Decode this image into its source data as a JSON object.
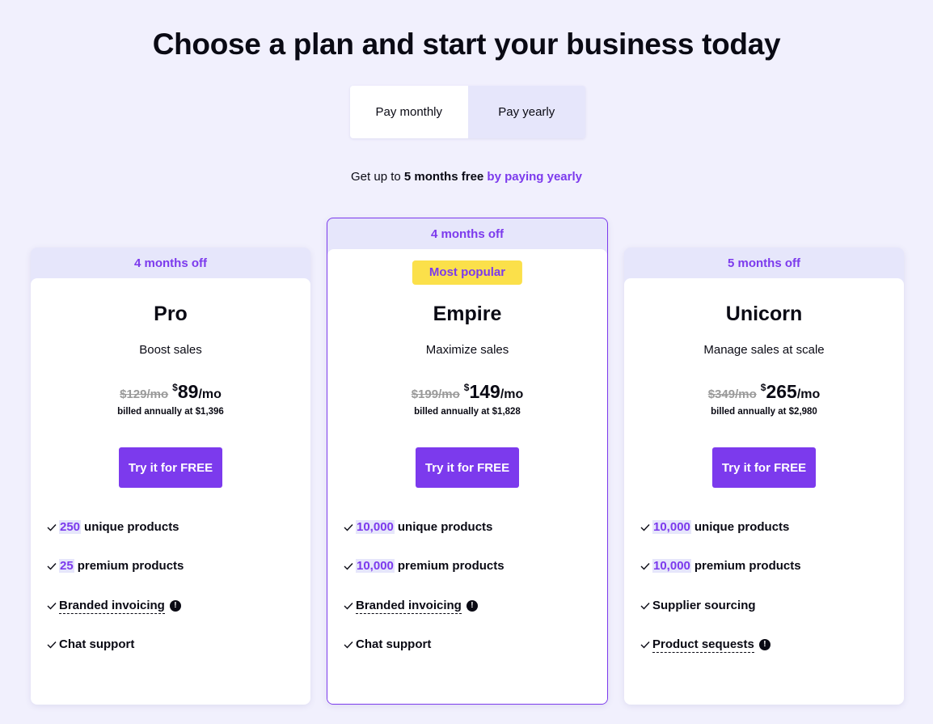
{
  "headline": "Choose a plan and start your business today",
  "billing_toggle": {
    "monthly_label": "Pay monthly",
    "yearly_label": "Pay yearly",
    "selected": "yearly"
  },
  "promo": {
    "prefix": "Get up to ",
    "bold": "5 months free",
    "accent": "by paying yearly"
  },
  "colors": {
    "page_bg": "#f1f0fd",
    "accent": "#7c3aed",
    "ribbon_bg": "#e6e6fb",
    "badge_bg": "#fbe04a"
  },
  "plans": [
    {
      "ribbon": "4 months off",
      "badge": "",
      "name": "Pro",
      "tagline": "Boost sales",
      "old_price": "$129/mo",
      "currency": "$",
      "price": "89",
      "period": "/mo",
      "billed": "billed annually at $1,396",
      "cta": "Try it for FREE",
      "features": [
        {
          "highlight": "250",
          "text": "unique products",
          "dashed": false,
          "info": false
        },
        {
          "highlight": "25",
          "text": "premium products",
          "dashed": false,
          "info": false
        },
        {
          "highlight": "",
          "text": "Branded invoicing",
          "dashed": true,
          "info": true
        },
        {
          "highlight": "",
          "text": "Chat support",
          "dashed": false,
          "info": false
        }
      ]
    },
    {
      "ribbon": "4 months off",
      "badge": "Most popular",
      "name": "Empire",
      "tagline": "Maximize sales",
      "old_price": "$199/mo",
      "currency": "$",
      "price": "149",
      "period": "/mo",
      "billed": "billed annually at $1,828",
      "cta": "Try it for FREE",
      "features": [
        {
          "highlight": "10,000",
          "text": "unique products",
          "dashed": false,
          "info": false
        },
        {
          "highlight": "10,000",
          "text": "premium products",
          "dashed": false,
          "info": false
        },
        {
          "highlight": "",
          "text": "Branded invoicing",
          "dashed": true,
          "info": true
        },
        {
          "highlight": "",
          "text": "Chat support",
          "dashed": false,
          "info": false
        }
      ]
    },
    {
      "ribbon": "5 months off",
      "badge": "",
      "name": "Unicorn",
      "tagline": "Manage sales at scale",
      "old_price": "$349/mo",
      "currency": "$",
      "price": "265",
      "period": "/mo",
      "billed": "billed annually at $2,980",
      "cta": "Try it for FREE",
      "features": [
        {
          "highlight": "10,000",
          "text": "unique products",
          "dashed": false,
          "info": false
        },
        {
          "highlight": "10,000",
          "text": "premium products",
          "dashed": false,
          "info": false
        },
        {
          "highlight": "",
          "text": "Supplier sourcing",
          "dashed": false,
          "info": false
        },
        {
          "highlight": "",
          "text": "Product sequests",
          "dashed": true,
          "info": true
        }
      ]
    }
  ],
  "icons": {
    "check": "check-icon",
    "info": "info-icon"
  }
}
